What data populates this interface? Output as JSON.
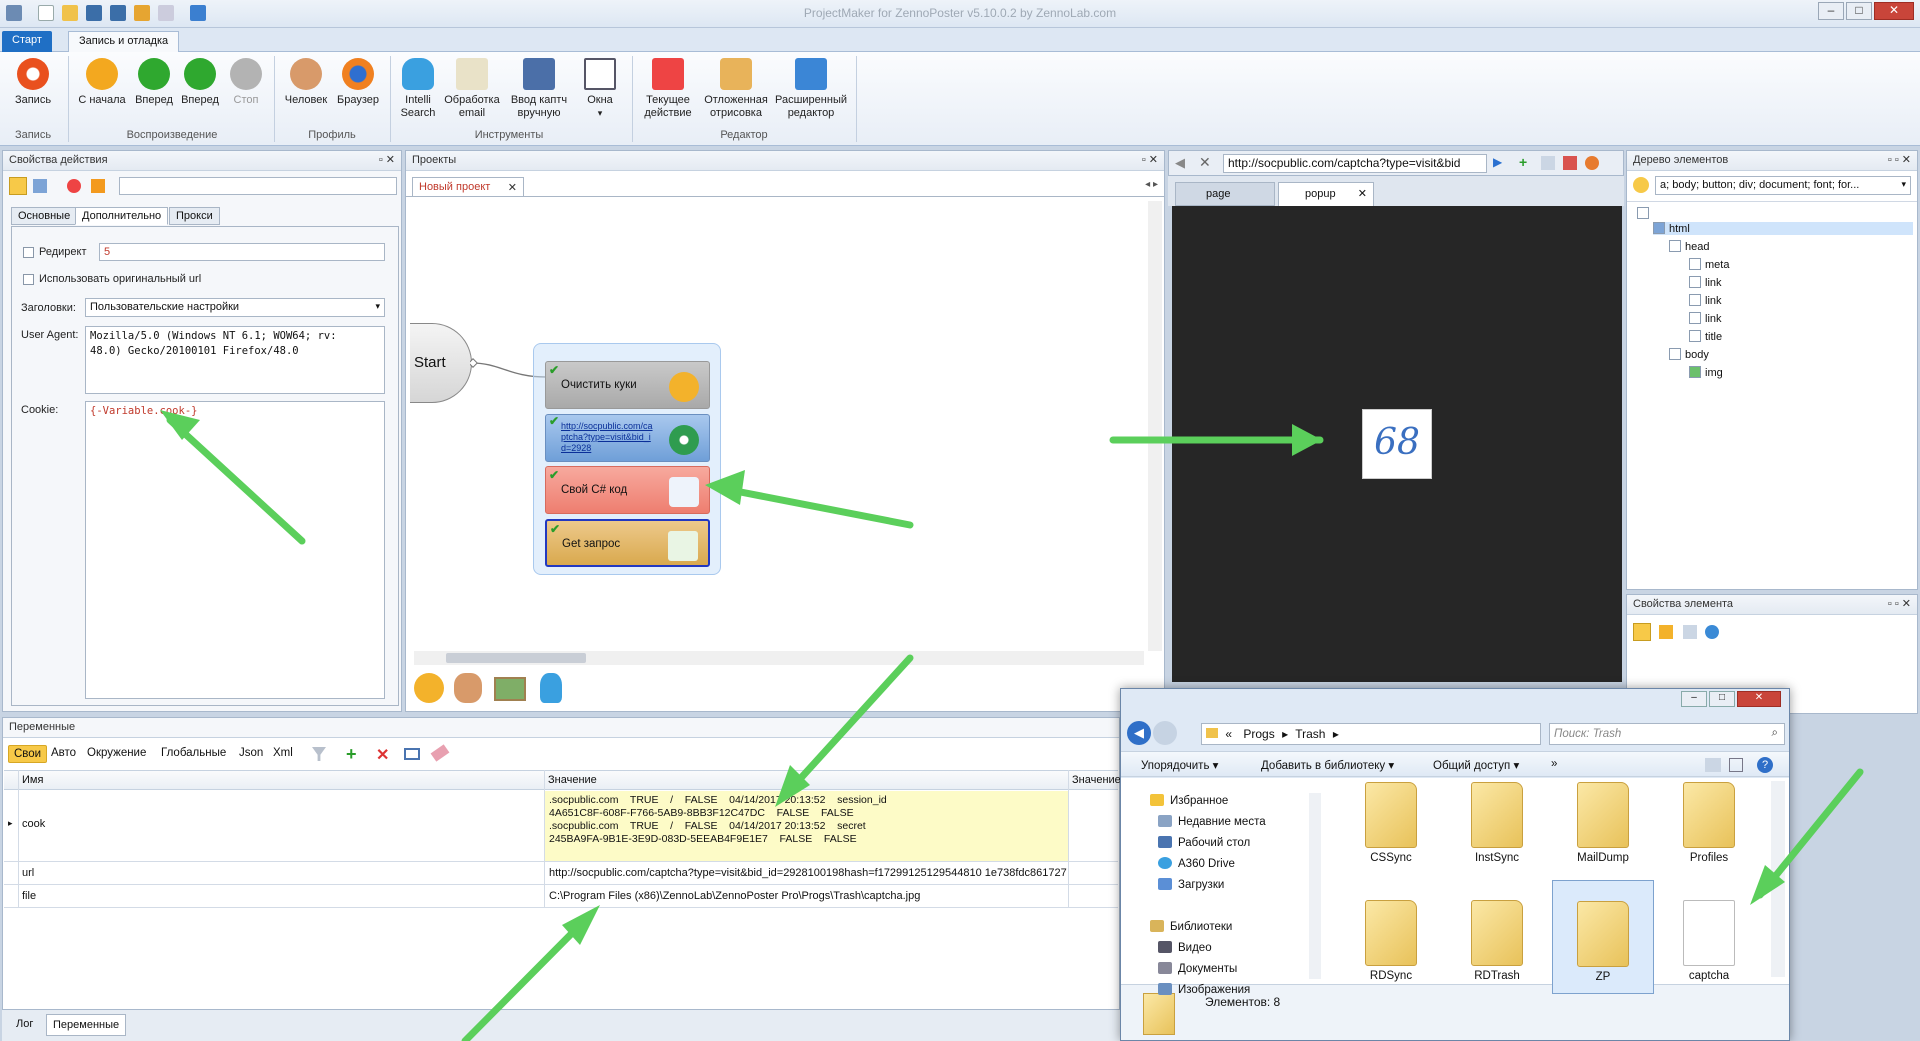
{
  "window": {
    "title": "ProjectMaker for ZennoPoster v5.10.0.2 by ZennoLab.com",
    "controls": [
      "–",
      "□",
      "✕"
    ]
  },
  "ribbon": {
    "tabs": [
      "Старт",
      "Запись и отладка"
    ],
    "groups": [
      {
        "label": "Запись",
        "buttons": [
          "Запись"
        ]
      },
      {
        "label": "Воспроизведение",
        "buttons": [
          "С начала",
          "Вперед",
          "Вперед",
          "Стоп"
        ]
      },
      {
        "label": "Профиль",
        "buttons": [
          "Человек",
          "Браузер"
        ]
      },
      {
        "label": "Инструменты",
        "buttons": [
          "Intelli Search",
          "Обработка email",
          "Ввод каптч вручную",
          "Окна"
        ]
      },
      {
        "label": "Редактор",
        "buttons": [
          "Текущее действие",
          "Отложенная отрисовка",
          "Расширенный редактор"
        ]
      }
    ],
    "colors": {
      "record": "#e9501e",
      "play": "#2fa82f",
      "stop": "#9a9a9a",
      "accent": "#1f6fc5"
    }
  },
  "props": {
    "title": "Свойства действия",
    "tabs": [
      "Основные",
      "Дополнительно",
      "Прокси"
    ],
    "redirect_label": "Редирект",
    "redirect_value": "5",
    "use_original_url": "Использовать оригинальный url",
    "headers_label": "Заголовки:",
    "headers_value": "Пользовательские настройки",
    "ua_label": "User Agent:",
    "ua_value": "Mozilla/5.0 (Windows NT 6.1; WOW64; rv: 48.0) Gecko/20100101 Firefox/48.0",
    "cookie_label": "Cookie:",
    "cookie_value": "{-Variable.cook-}"
  },
  "projects": {
    "title": "Проекты",
    "tab": "Новый проект",
    "start_label": "Start",
    "blocks": [
      {
        "label": "Очистить куки",
        "color": "#b3b3b3"
      },
      {
        "label": "http://socpublic.com/captcha?type=visit&bid_id=2928",
        "color": "#7ea9dc"
      },
      {
        "label": "Свой C# код",
        "color": "#f08a7c"
      },
      {
        "label": "Get запрос",
        "color": "#e2b55e"
      }
    ]
  },
  "browser": {
    "url": "http://socpublic.com/captcha?type=visit&bid",
    "tabs": [
      "page",
      "popup"
    ],
    "captcha_text": "68"
  },
  "tree": {
    "title": "Дерево элементов",
    "filter": "a; body; button; div; document; font; for...",
    "nodes": [
      "html",
      "head",
      "meta",
      "link",
      "link",
      "link",
      "title",
      "body",
      "img"
    ]
  },
  "element_props": {
    "title": "Свойства элемента"
  },
  "variables": {
    "title": "Переменные",
    "tabs": [
      "Свои",
      "Авто",
      "Окружение",
      "Глобальные",
      "Json",
      "Xml"
    ],
    "columns": [
      "Имя",
      "Значение",
      "Значение"
    ],
    "rows": [
      {
        "name": "cook",
        "value_lines": [
          ".socpublic.com    TRUE    /    FALSE    04/14/2017 20:13:52    session_id",
          "4A651C8F-608F-F766-5AB9-8BB3F12C47DC    FALSE    FALSE",
          ".socpublic.com    TRUE    /    FALSE    04/14/2017 20:13:52    secret",
          "245BA9FA-9B1E-3E9D-083D-5EEAB4F9E1E7    FALSE    FALSE"
        ]
      },
      {
        "name": "url",
        "value": "http://socpublic.com/captcha?type=visit&bid_id=2928100198hash=f17299125129544810 1e738fdc861727"
      },
      {
        "name": "file",
        "value": "C:\\Program Files (x86)\\ZennoLab\\ZennoPoster Pro\\Progs\\Trash\\captcha.jpg"
      }
    ],
    "bottom_tabs": [
      "Лог",
      "Переменные"
    ]
  },
  "explorer": {
    "breadcrumb": [
      "«",
      "Progs",
      "Trash"
    ],
    "search_placeholder": "Поиск: Trash",
    "toolbar": [
      "Упорядочить ▾",
      "Добавить в библиотеку ▾",
      "Общий доступ ▾",
      "»"
    ],
    "nav": [
      "Избранное",
      "Недавние места",
      "Рабочий стол",
      "A360 Drive",
      "Загрузки",
      "Библиотеки",
      "Видео",
      "Документы",
      "Изображения"
    ],
    "folders": [
      "CSSync",
      "InstSync",
      "MailDump",
      "Profiles",
      "RDSync",
      "RDTrash",
      "ZP",
      "captcha"
    ],
    "status": "Элементов: 8"
  }
}
